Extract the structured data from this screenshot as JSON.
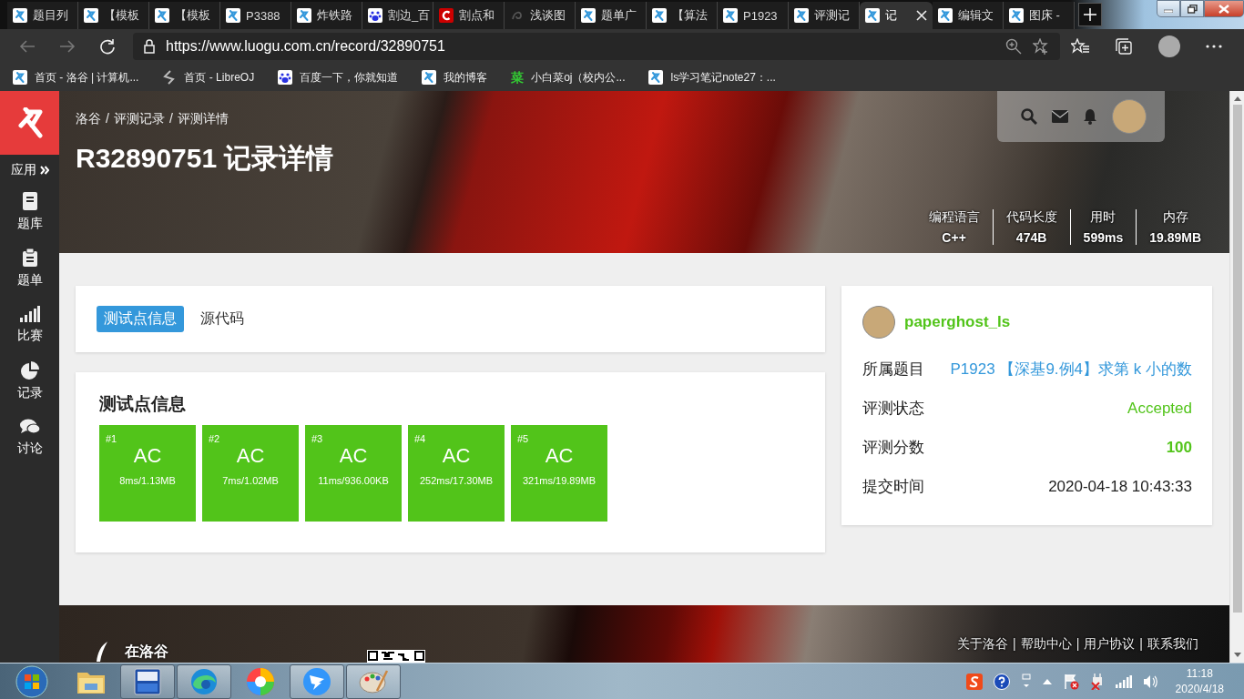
{
  "browser": {
    "tabs": [
      {
        "title": "题目列",
        "kind": "luogu",
        "selected": false
      },
      {
        "title": "【模板",
        "kind": "luogu",
        "selected": false
      },
      {
        "title": "【模板",
        "kind": "luogu",
        "selected": false
      },
      {
        "title": "P3388",
        "kind": "luogu",
        "selected": false
      },
      {
        "title": "炸铁路",
        "kind": "luogu",
        "selected": false
      },
      {
        "title": "割边_百",
        "kind": "baidu",
        "selected": false
      },
      {
        "title": "割点和",
        "kind": "csdn",
        "selected": false
      },
      {
        "title": "浅谈图",
        "kind": "dark",
        "selected": false
      },
      {
        "title": "题单广",
        "kind": "luogu",
        "selected": false
      },
      {
        "title": "【算法",
        "kind": "luogu",
        "selected": false
      },
      {
        "title": "P1923",
        "kind": "luogu",
        "selected": false
      },
      {
        "title": "评测记",
        "kind": "luogu",
        "selected": false
      },
      {
        "title": "记",
        "kind": "luogu",
        "selected": true
      },
      {
        "title": "编辑文",
        "kind": "luogu",
        "selected": false
      },
      {
        "title": "图床 -",
        "kind": "luogu",
        "selected": false
      }
    ],
    "url": "https://www.luogu.com.cn/record/32890751",
    "bookmarks": [
      {
        "label": "首页 - 洛谷 | 计算机...",
        "kind": "luogu"
      },
      {
        "label": "首页 - LibreOJ",
        "kind": "libreoj"
      },
      {
        "label": "百度一下，你就知道",
        "kind": "baidu"
      },
      {
        "label": "我的博客",
        "kind": "luogu"
      },
      {
        "label": "小白菜oj（校内公...",
        "kind": "text",
        "icon_text": "菜"
      },
      {
        "label": "ls学习笔记note27：...",
        "kind": "luogu"
      }
    ]
  },
  "sidebar": {
    "apps_label": "应用",
    "items": [
      {
        "label": "题库",
        "kind": "book"
      },
      {
        "label": "题单",
        "kind": "clipboard"
      },
      {
        "label": "比赛",
        "kind": "bars"
      },
      {
        "label": "记录",
        "kind": "pie"
      },
      {
        "label": "讨论",
        "kind": "chat"
      }
    ]
  },
  "header": {
    "breadcrumb": [
      "洛谷",
      "评测记录",
      "评测详情"
    ],
    "breadcrumb_separator": "/",
    "title": "R32890751 记录详情",
    "stats": [
      {
        "label": "编程语言",
        "value": "C++"
      },
      {
        "label": "代码长度",
        "value": "474B"
      },
      {
        "label": "用时",
        "value": "599ms"
      },
      {
        "label": "内存",
        "value": "19.89MB"
      }
    ]
  },
  "tabs": [
    {
      "label": "测试点信息",
      "selected": true
    },
    {
      "label": "源代码",
      "selected": false
    }
  ],
  "test_panel": {
    "title": "测试点信息",
    "cases": [
      {
        "number": "#1",
        "status": "AC",
        "detail": "8ms/1.13MB"
      },
      {
        "number": "#2",
        "status": "AC",
        "detail": "7ms/1.02MB"
      },
      {
        "number": "#3",
        "status": "AC",
        "detail": "11ms/936.00KB"
      },
      {
        "number": "#4",
        "status": "AC",
        "detail": "252ms/17.30MB"
      },
      {
        "number": "#5",
        "status": "AC",
        "detail": "321ms/19.89MB"
      }
    ]
  },
  "record": {
    "username": "paperghost_ls",
    "fields": [
      {
        "label": "所属题目",
        "kind": "link",
        "value": "P1923 【深基9.例4】求第 k 小的数"
      },
      {
        "label": "评测状态",
        "kind": "status",
        "value": "Accepted"
      },
      {
        "label": "评测分数",
        "kind": "score",
        "value": "100"
      },
      {
        "label": "提交时间",
        "kind": "text",
        "value": "2020-04-18 10:43:33"
      }
    ]
  },
  "footer": {
    "brand": "在洛谷",
    "links": [
      "关于洛谷",
      "帮助中心",
      "用户协议",
      "联系我们"
    ],
    "separator": "|"
  },
  "taskbar": {
    "apps": [
      {
        "kind": "folder",
        "running": false
      },
      {
        "kind": "devcpp",
        "running": true
      },
      {
        "kind": "edge",
        "running": true
      },
      {
        "kind": "pinwheel",
        "running": false
      },
      {
        "kind": "dingtalk",
        "running": true
      },
      {
        "kind": "paint",
        "running": true
      }
    ],
    "time": "11:18",
    "date": "2020/4/18"
  }
}
